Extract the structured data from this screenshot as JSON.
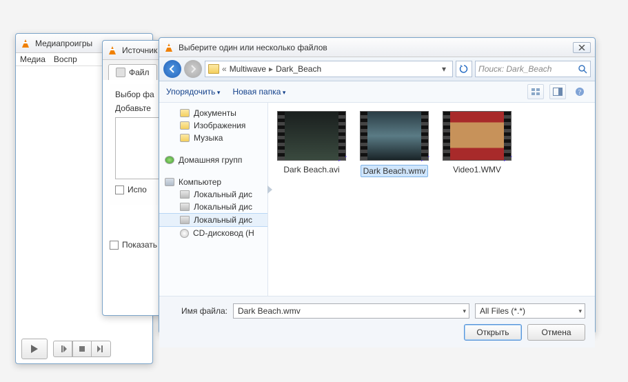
{
  "background_window": {
    "title": "Медиапроигры",
    "menu": [
      "Медиа",
      "Воспр"
    ]
  },
  "source_window": {
    "title": "Источник",
    "tab_label": "Файл",
    "selector_label": "Выбор фа",
    "add_label": "Добавьте",
    "use_checkbox": "Испо",
    "show_checkbox": "Показать"
  },
  "file_dialog": {
    "title": "Выберите один или несколько файлов",
    "breadcrumb": {
      "prefix": "«",
      "p1": "Multiwave",
      "p2": "Dark_Beach"
    },
    "search_placeholder": "Поиск: Dark_Beach",
    "toolbar": {
      "organize": "Упорядочить",
      "newfolder": "Новая папка"
    },
    "sidebar": {
      "documents": "Документы",
      "images": "Изображения",
      "music": "Музыка",
      "homegroup": "Домашняя групп",
      "computer": "Компьютер",
      "local1": "Локальный дис",
      "local2": "Локальный дис",
      "local3": "Локальный дис",
      "cd": "CD-дисковод (H"
    },
    "files": [
      {
        "name": "Dark Beach.avi"
      },
      {
        "name": "Dark Beach.wmv",
        "selected": true
      },
      {
        "name": "Video1.WMV"
      }
    ],
    "filename_label": "Имя файла:",
    "filename_value": "Dark Beach.wmv",
    "filter_value": "All Files (*.*)",
    "open_btn": "Открыть",
    "cancel_btn": "Отмена"
  }
}
